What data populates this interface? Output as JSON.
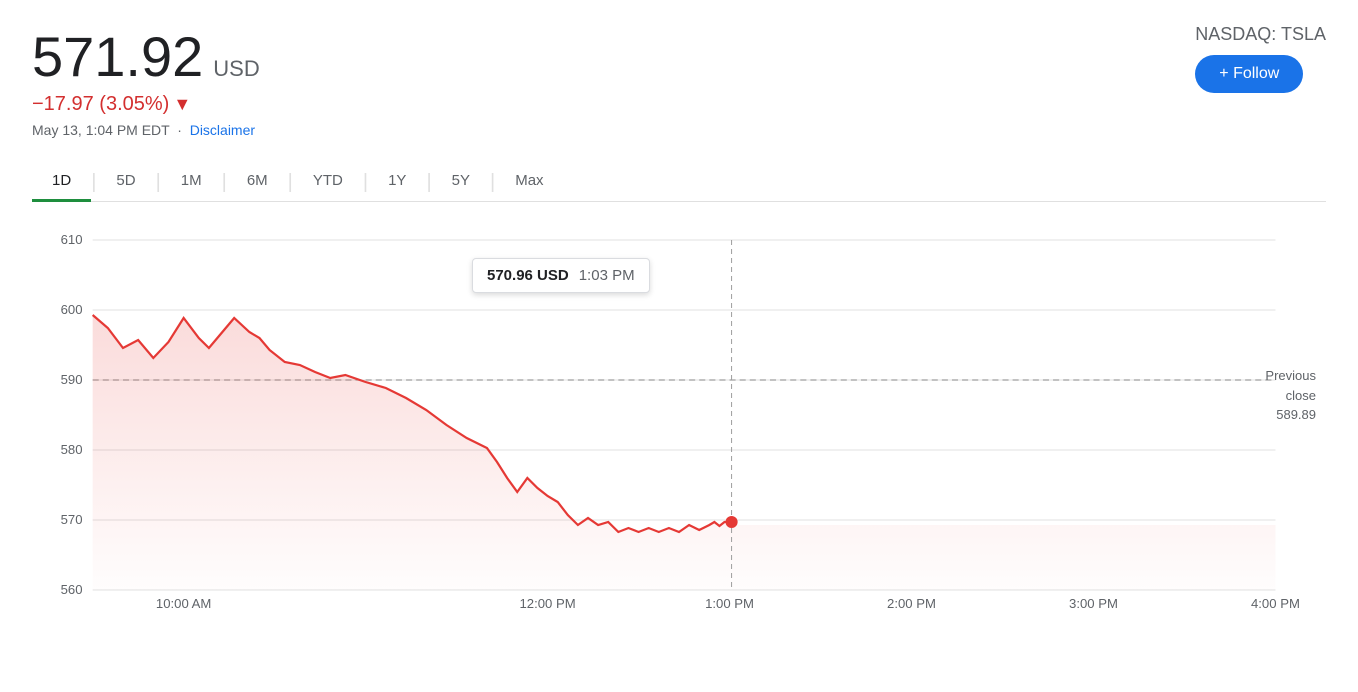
{
  "header": {
    "price": "571.92",
    "currency": "USD",
    "change": "−17.97 (3.05%)",
    "change_arrow": "▼",
    "date": "May 13, 1:04 PM EDT",
    "disclaimer": "Disclaimer",
    "ticker": "NASDAQ: TSLA",
    "follow_label": "+ Follow"
  },
  "tabs": [
    {
      "label": "1D",
      "active": true
    },
    {
      "label": "5D",
      "active": false
    },
    {
      "label": "1M",
      "active": false
    },
    {
      "label": "6M",
      "active": false
    },
    {
      "label": "YTD",
      "active": false
    },
    {
      "label": "1Y",
      "active": false
    },
    {
      "label": "5Y",
      "active": false
    },
    {
      "label": "Max",
      "active": false
    }
  ],
  "chart": {
    "tooltip_price": "570.96 USD",
    "tooltip_time": "1:03 PM",
    "prev_close_label": "Previous\nclose\n589.89",
    "prev_close_value": "589.89",
    "y_labels": [
      "610",
      "600",
      "590",
      "580",
      "570",
      "560"
    ],
    "x_labels": [
      "10:00 AM",
      "12:00 PM",
      "1:00 PM",
      "2:00 PM",
      "3:00 PM",
      "4:00 PM"
    ]
  },
  "colors": {
    "accent_red": "#d32f2f",
    "accent_blue": "#1a73e8",
    "active_tab": "#1e8e3e"
  }
}
